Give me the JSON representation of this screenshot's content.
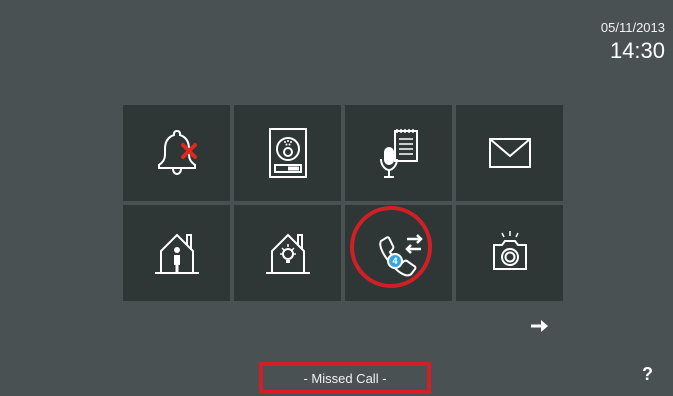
{
  "header": {
    "date": "05/11/2013",
    "time": "14:30"
  },
  "tiles": [
    {
      "id": "do-not-disturb",
      "icon": "bell-muted-icon"
    },
    {
      "id": "door-entry-panel",
      "icon": "door-panel-icon"
    },
    {
      "id": "voice-memo",
      "icon": "voice-memo-icon"
    },
    {
      "id": "messages",
      "icon": "envelope-icon"
    },
    {
      "id": "home-automation-presence",
      "icon": "house-person-icon"
    },
    {
      "id": "home-automation-lights",
      "icon": "house-light-icon"
    },
    {
      "id": "call-log",
      "icon": "call-log-icon",
      "badge": "4"
    },
    {
      "id": "camera-photos",
      "icon": "camera-icon"
    }
  ],
  "status": {
    "text": "- Missed Call -"
  },
  "help": {
    "label": "?"
  },
  "colors": {
    "background": "#4a5153",
    "tile": "#2f3636",
    "highlight": "#d11f26",
    "badge": "#3aa3e0"
  }
}
